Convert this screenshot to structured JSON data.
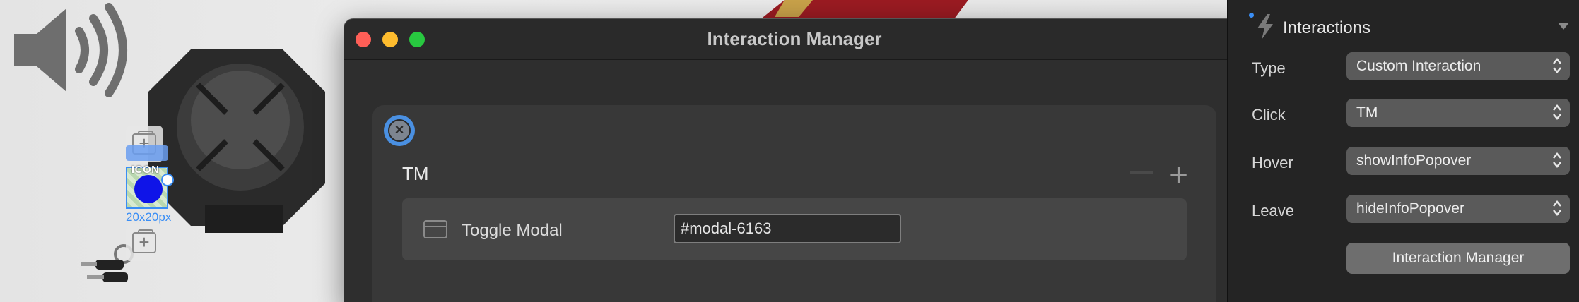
{
  "canvas": {
    "icon_label": "ICON",
    "size_label": "20x20px"
  },
  "window": {
    "title": "Interaction Manager",
    "card": {
      "title": "TM",
      "action": {
        "label": "Toggle Modal",
        "value": "#modal-6163"
      }
    }
  },
  "panel": {
    "title": "Interactions",
    "rows": [
      {
        "label": "Type",
        "value": "Custom Interaction"
      },
      {
        "label": "Click",
        "value": "TM"
      },
      {
        "label": "Hover",
        "value": "showInfoPopover"
      },
      {
        "label": "Leave",
        "value": "hideInfoPopover"
      }
    ],
    "button_label": "Interaction Manager"
  },
  "colors": {
    "accent": "#3a8ef5",
    "traffic_red": "#fe5f57",
    "traffic_yellow": "#febc2e",
    "traffic_green": "#28c840",
    "selected_dot": "#0f14e8"
  },
  "icons": [
    "speaker-icon",
    "plus-icon",
    "close-icon",
    "window-icon",
    "bolt-icon",
    "chevron-updown-icon",
    "triangle-down-icon"
  ]
}
